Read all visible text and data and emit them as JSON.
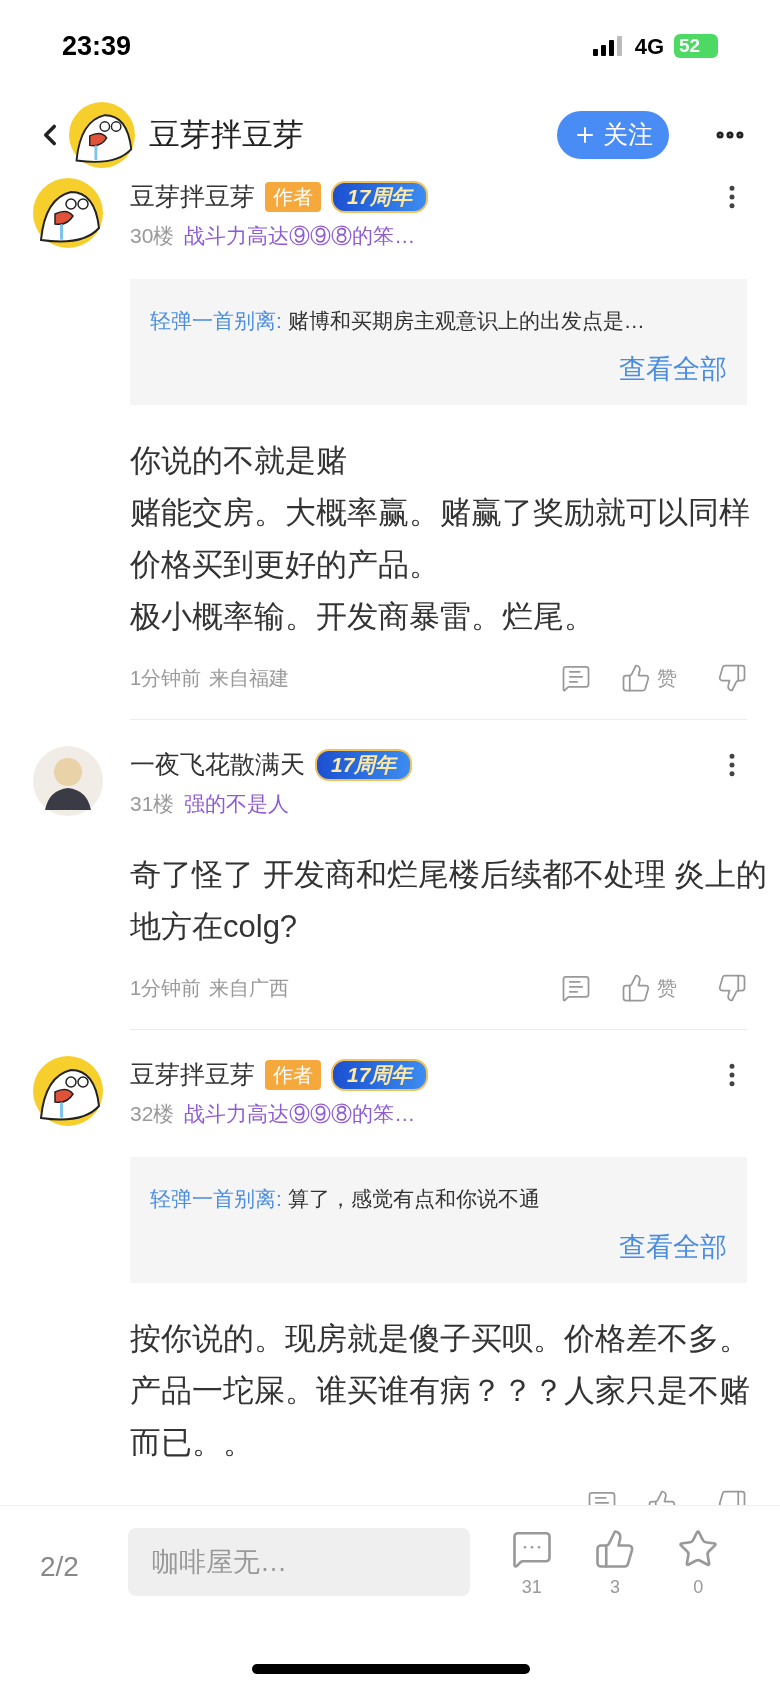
{
  "status_bar": {
    "time": "23:39",
    "network": "4G",
    "battery": "52"
  },
  "header": {
    "title": "豆芽拌豆芽",
    "avatar": {
      "kind": "duck"
    },
    "follow_button": "关注"
  },
  "comments": [
    {
      "author": "豆芽拌豆芽",
      "avatar": {
        "kind": "duck"
      },
      "badges": [
        {
          "kind": "author",
          "text": "作者"
        },
        {
          "kind": "anniversary",
          "text": "17周年"
        }
      ],
      "floor": "30楼",
      "user_title": "战斗力高达⑨⑨⑧的笨…",
      "quote": {
        "user": "轻弹一首别离:",
        "text": "赌博和买期房主观意识上的出发点是…",
        "more": "查看全部"
      },
      "body": [
        "你说的不就是赌",
        "赌能交房。大概率赢。赌赢了奖励就可以同样价格买到更好的产品。",
        "极小概率输。开发商暴雷。烂尾。"
      ],
      "time": "1分钟前",
      "location": "来自福建",
      "like_label": "赞"
    },
    {
      "author": "一夜飞花散满天",
      "avatar": {
        "kind": "character"
      },
      "badges": [
        {
          "kind": "anniversary",
          "text": "17周年"
        }
      ],
      "floor": "31楼",
      "user_title": "强的不是人",
      "body": [
        "奇了怪了 开发商和烂尾楼后续都不处理 炎上的地方在colg?"
      ],
      "time": "1分钟前",
      "location": "来自广西",
      "like_label": "赞"
    },
    {
      "author": "豆芽拌豆芽",
      "avatar": {
        "kind": "duck"
      },
      "badges": [
        {
          "kind": "author",
          "text": "作者"
        },
        {
          "kind": "anniversary",
          "text": "17周年"
        }
      ],
      "floor": "32楼",
      "user_title": "战斗力高达⑨⑨⑧的笨…",
      "quote": {
        "user": "轻弹一首别离:",
        "text": "算了，感觉有点和你说不通",
        "more": "查看全部"
      },
      "body": [
        "按你说的。现房就是傻子买呗。价格差不多。产品一坨屎。谁买谁有病？？？人家只是不赌而已。。"
      ]
    }
  ],
  "bottom_bar": {
    "page": "2/2",
    "placeholder": "咖啡屋无…",
    "comment_count": "31",
    "like_count": "3",
    "favorite_count": "0"
  }
}
